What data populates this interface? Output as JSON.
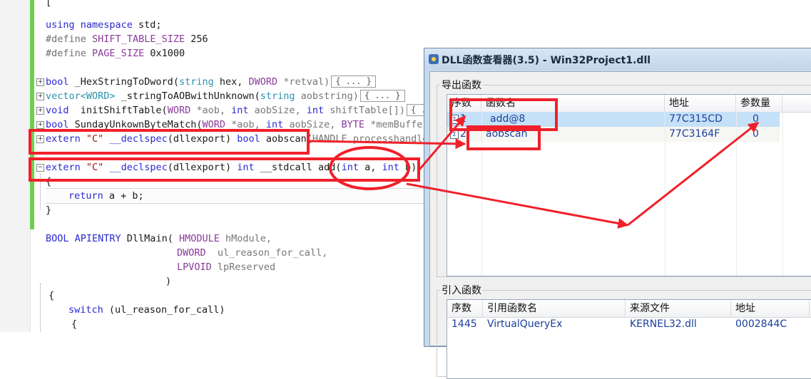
{
  "editor": {
    "lines": {
      "l1": {
        "kw": "using namespace",
        "rest": " std;"
      },
      "l2": {
        "pp": "#define",
        "name": "SHIFT_TABLE_SIZE",
        "val": " 256"
      },
      "l3": {
        "pp": "#define",
        "name": "PAGE_SIZE",
        "val": " 0x1000"
      },
      "l4": {
        "a": "bool",
        "b": " _HexStringToDword(",
        "c": "string",
        "d": " hex, ",
        "e": "DWORD",
        "f": " *retval)",
        "ell": "{ ... }"
      },
      "l5": {
        "a": "vector<WORD>",
        "b": " _stringToAOBwithUnknown(",
        "c": "string",
        "d": " aobstring)",
        "ell": "{ ... }"
      },
      "l6": {
        "a": "void",
        "b": "  initShiftTable(",
        "c": "WORD",
        "d": " *aob, ",
        "e": "int",
        "f": " aobSize, ",
        "g": "int",
        "h": " shiftTable[])",
        "ell": "{ ..."
      },
      "l7": {
        "a": "bool",
        "b": " SundayUnkownByteMatch(",
        "c": "WORD",
        "d": " *aob, ",
        "e": "int",
        "f": " aobSize, ",
        "g": "BYTE",
        "h": " *memBuffer,"
      },
      "l8": {
        "a": "extern",
        "b": " \"C\" ",
        "c": "__declspec",
        "d": "(dllexport) ",
        "e": "bool",
        "f": " aobscan(",
        "g": "HANDLE processhandle,"
      },
      "l9": {
        "a": "extern",
        "b": " \"C\" ",
        "c": "__declspec",
        "d": "(dllexport) ",
        "e": "int",
        "f": " __stdcall add(",
        "g": "int",
        "h": " a, ",
        "i": "int",
        "j": " b)"
      },
      "l10": {
        "t": "{"
      },
      "l11": {
        "kw": "return",
        "rest": " a + b;"
      },
      "l12": {
        "t": "}"
      },
      "l13": {
        "a": "BOOL APIENTRY",
        "b": " DllMain( ",
        "c": "HMODULE",
        "d": " hModule,"
      },
      "l14": {
        "c": "DWORD",
        "d": "  ul_reason_for_call,"
      },
      "l15": {
        "c": "LPVOID",
        "d": " lpReserved"
      },
      "l16": {
        "t": ")"
      },
      "l17": {
        "t": "{"
      },
      "l18": {
        "kw": "switch",
        "rest": " (ul_reason_for_call)"
      },
      "l19": {
        "t": "{"
      },
      "l0": {
        "t": "["
      }
    }
  },
  "dialog": {
    "title": "DLL函数查看器(3.5) - Win32Project1.dll",
    "exports": {
      "label": "导出函数",
      "headers": [
        "序数",
        "函数名",
        "地址",
        "参数量"
      ],
      "rows": [
        {
          "ord": "1",
          "name": "add@8",
          "addr": "77C315CD",
          "params": "0"
        },
        {
          "ord": "2",
          "name": "aobscan",
          "addr": "77C3164F",
          "params": "0"
        }
      ]
    },
    "imports": {
      "label": "引入函数",
      "headers": [
        "序数",
        "引用函数名",
        "来源文件",
        "地址"
      ],
      "rows": [
        {
          "ord": "1445",
          "name": "VirtualQueryEx",
          "file": "KERNEL32.dll",
          "addr": "0002844C"
        }
      ]
    }
  },
  "colors": {
    "annotation": "#f0202a",
    "selection": "#c5e1f7",
    "change_bar": "#6fce4d"
  }
}
